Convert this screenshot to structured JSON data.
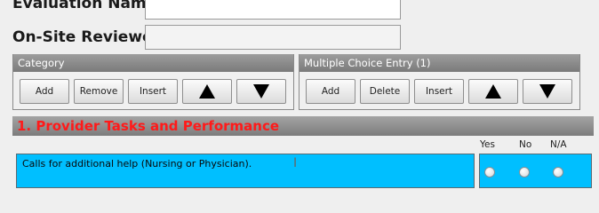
{
  "form": {
    "evaluation_name_label": "Evaluation Name:",
    "evaluation_name_value": "",
    "reviewer_label": "On-Site Reviewer:",
    "reviewer_value": ""
  },
  "category_panel": {
    "title": "Category",
    "add": "Add",
    "remove": "Remove",
    "insert": "Insert"
  },
  "mc_panel": {
    "title": "Multiple Choice Entry (1)",
    "add": "Add",
    "delete": "Delete",
    "insert": "Insert"
  },
  "section": {
    "title": "1. Provider Tasks and Performance",
    "columns": [
      "Yes",
      "No",
      "N/A"
    ],
    "question": "Calls for additional help (Nursing or Physician)."
  },
  "colors": {
    "answer_background": "#00bfff",
    "section_title": "#ff1a1a"
  }
}
